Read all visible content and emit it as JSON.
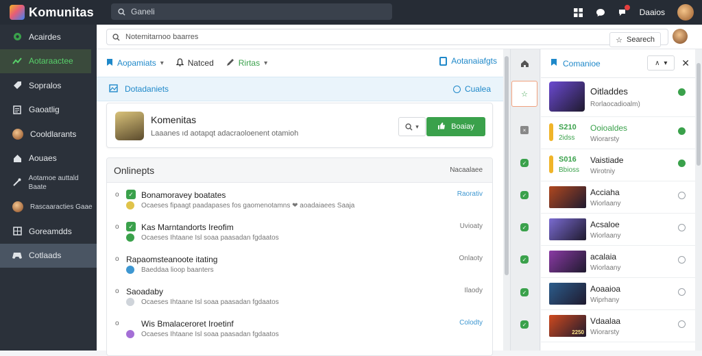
{
  "app": {
    "title": "Komunitas",
    "search_placeholder": "Ganeli"
  },
  "topbar": {
    "username": "Daaios"
  },
  "sidebar": {
    "items": [
      {
        "label": "Acairdes",
        "icon": "circle-icon"
      },
      {
        "label": "Aotaraactee",
        "icon": "trending-icon"
      },
      {
        "label": "Sopralos",
        "icon": "tag-icon"
      },
      {
        "label": "Gaoatlig",
        "icon": "document-icon"
      },
      {
        "label": "Cooldlarants",
        "icon": "avatar"
      },
      {
        "label": "Aouaes",
        "icon": "house-icon"
      },
      {
        "label": "Aotamoe auttald Baate",
        "icon": "tools-icon"
      },
      {
        "label": "Rascaaracties Gaae",
        "icon": "avatar"
      },
      {
        "label": "Goreamdds",
        "icon": "grid-icon"
      },
      {
        "label": "Cotlaads",
        "icon": "gamepad-icon"
      }
    ]
  },
  "subbar": {
    "input_value": "Notemitarnoo baarres",
    "search_label": "Searech"
  },
  "tabs": [
    {
      "label": "Aopamiats",
      "caret": true
    },
    {
      "label": "Natced",
      "caret": false
    },
    {
      "label": "Rirtas",
      "caret": true
    }
  ],
  "tab_right": "Aotanaiafgts",
  "info": {
    "left": "Dotadaniets",
    "right": "Cualea"
  },
  "community_card": {
    "title": "Komenitas",
    "subtitle": "Laaanes ıd aotapqt adacraoloenent otamioh",
    "button": "Boaiay"
  },
  "online": {
    "title": "Onlinepts",
    "right_label": "Nacaalaee",
    "items": [
      {
        "title": "Bonamoravey boatates",
        "sub": "Ocaeses fipaagt paadapases fos gaomenotamns ❤ aoadaiaees Saaja",
        "status": "Raorativ",
        "status_blue": true,
        "icon_color": "#3aa14b",
        "sub_icon_color": "#e0c34a"
      },
      {
        "title": "Kas Marntandorts Ireofim",
        "sub": "Ocaeses Ihtaane Isl soaa paasadan fgdaatos",
        "status": "Uvioaty",
        "status_blue": false,
        "icon_color": "#3aa14b",
        "sub_icon_color": "#3aa14b"
      },
      {
        "title": "Rapaomsteanoote itating",
        "sub": "Baeddaa lioop baanters",
        "status": "Onlaoty",
        "status_blue": false,
        "icon_color": "none",
        "sub_icon_color": "#3e97d1"
      },
      {
        "title": "Saoadaby",
        "sub": "Ocaeses Ihtaane Isl soaa paasadan fgdaatos",
        "status": "Ilaody",
        "status_blue": false,
        "icon_color": "none",
        "sub_icon_color": "#cfd4da"
      },
      {
        "title": "Wis Bmalaceroret Iroetinf",
        "sub": "Ocaeses Ihtaane Isl soaa paasadan fgdaatos",
        "status": "Colodty",
        "status_blue": true,
        "icon_color": "none",
        "sub_icon_color": "#a46fd6"
      }
    ]
  },
  "right_panel": {
    "title": "Comanioe",
    "dropdown": "∧",
    "items": [
      {
        "title": "Oitladdes",
        "sub": "Rorlaocadioalm)",
        "mark": "green",
        "big": true,
        "thumb": "#6b4ad1"
      },
      {
        "title": "Ooioaldes",
        "sub": "Wiorarsty",
        "mark": "green",
        "price": "S210",
        "price2": "2idss",
        "title_green": true
      },
      {
        "title": "Vaistiade",
        "sub": "Wirotniy",
        "mark": "green",
        "price": "S016",
        "price2": "Bbioss",
        "title_green": false
      },
      {
        "title": "Acciaha",
        "sub": "Wiorlaany",
        "mark": "ring",
        "thumb": "#b0481f"
      },
      {
        "title": "Acsaloe",
        "sub": "Wiorlaany",
        "mark": "ring",
        "thumb": "#7a6bd1"
      },
      {
        "title": "acalaia",
        "sub": "Wiorlaany",
        "mark": "ring",
        "thumb": "#8a3aa4"
      },
      {
        "title": "Aoaaioa",
        "sub": "Wiprhany",
        "mark": "ring",
        "thumb": "#2c5d8c"
      },
      {
        "title": "Vdaalaa",
        "sub": "Wiorarsty",
        "mark": "ring",
        "thumb": "#d04a1e",
        "thumb_label": "2250"
      }
    ]
  },
  "colors": {
    "accent_green": "#3aa14b",
    "accent_blue": "#1e88c9",
    "topbar_bg": "#262c35",
    "sidebar_bg": "#2b313a"
  }
}
